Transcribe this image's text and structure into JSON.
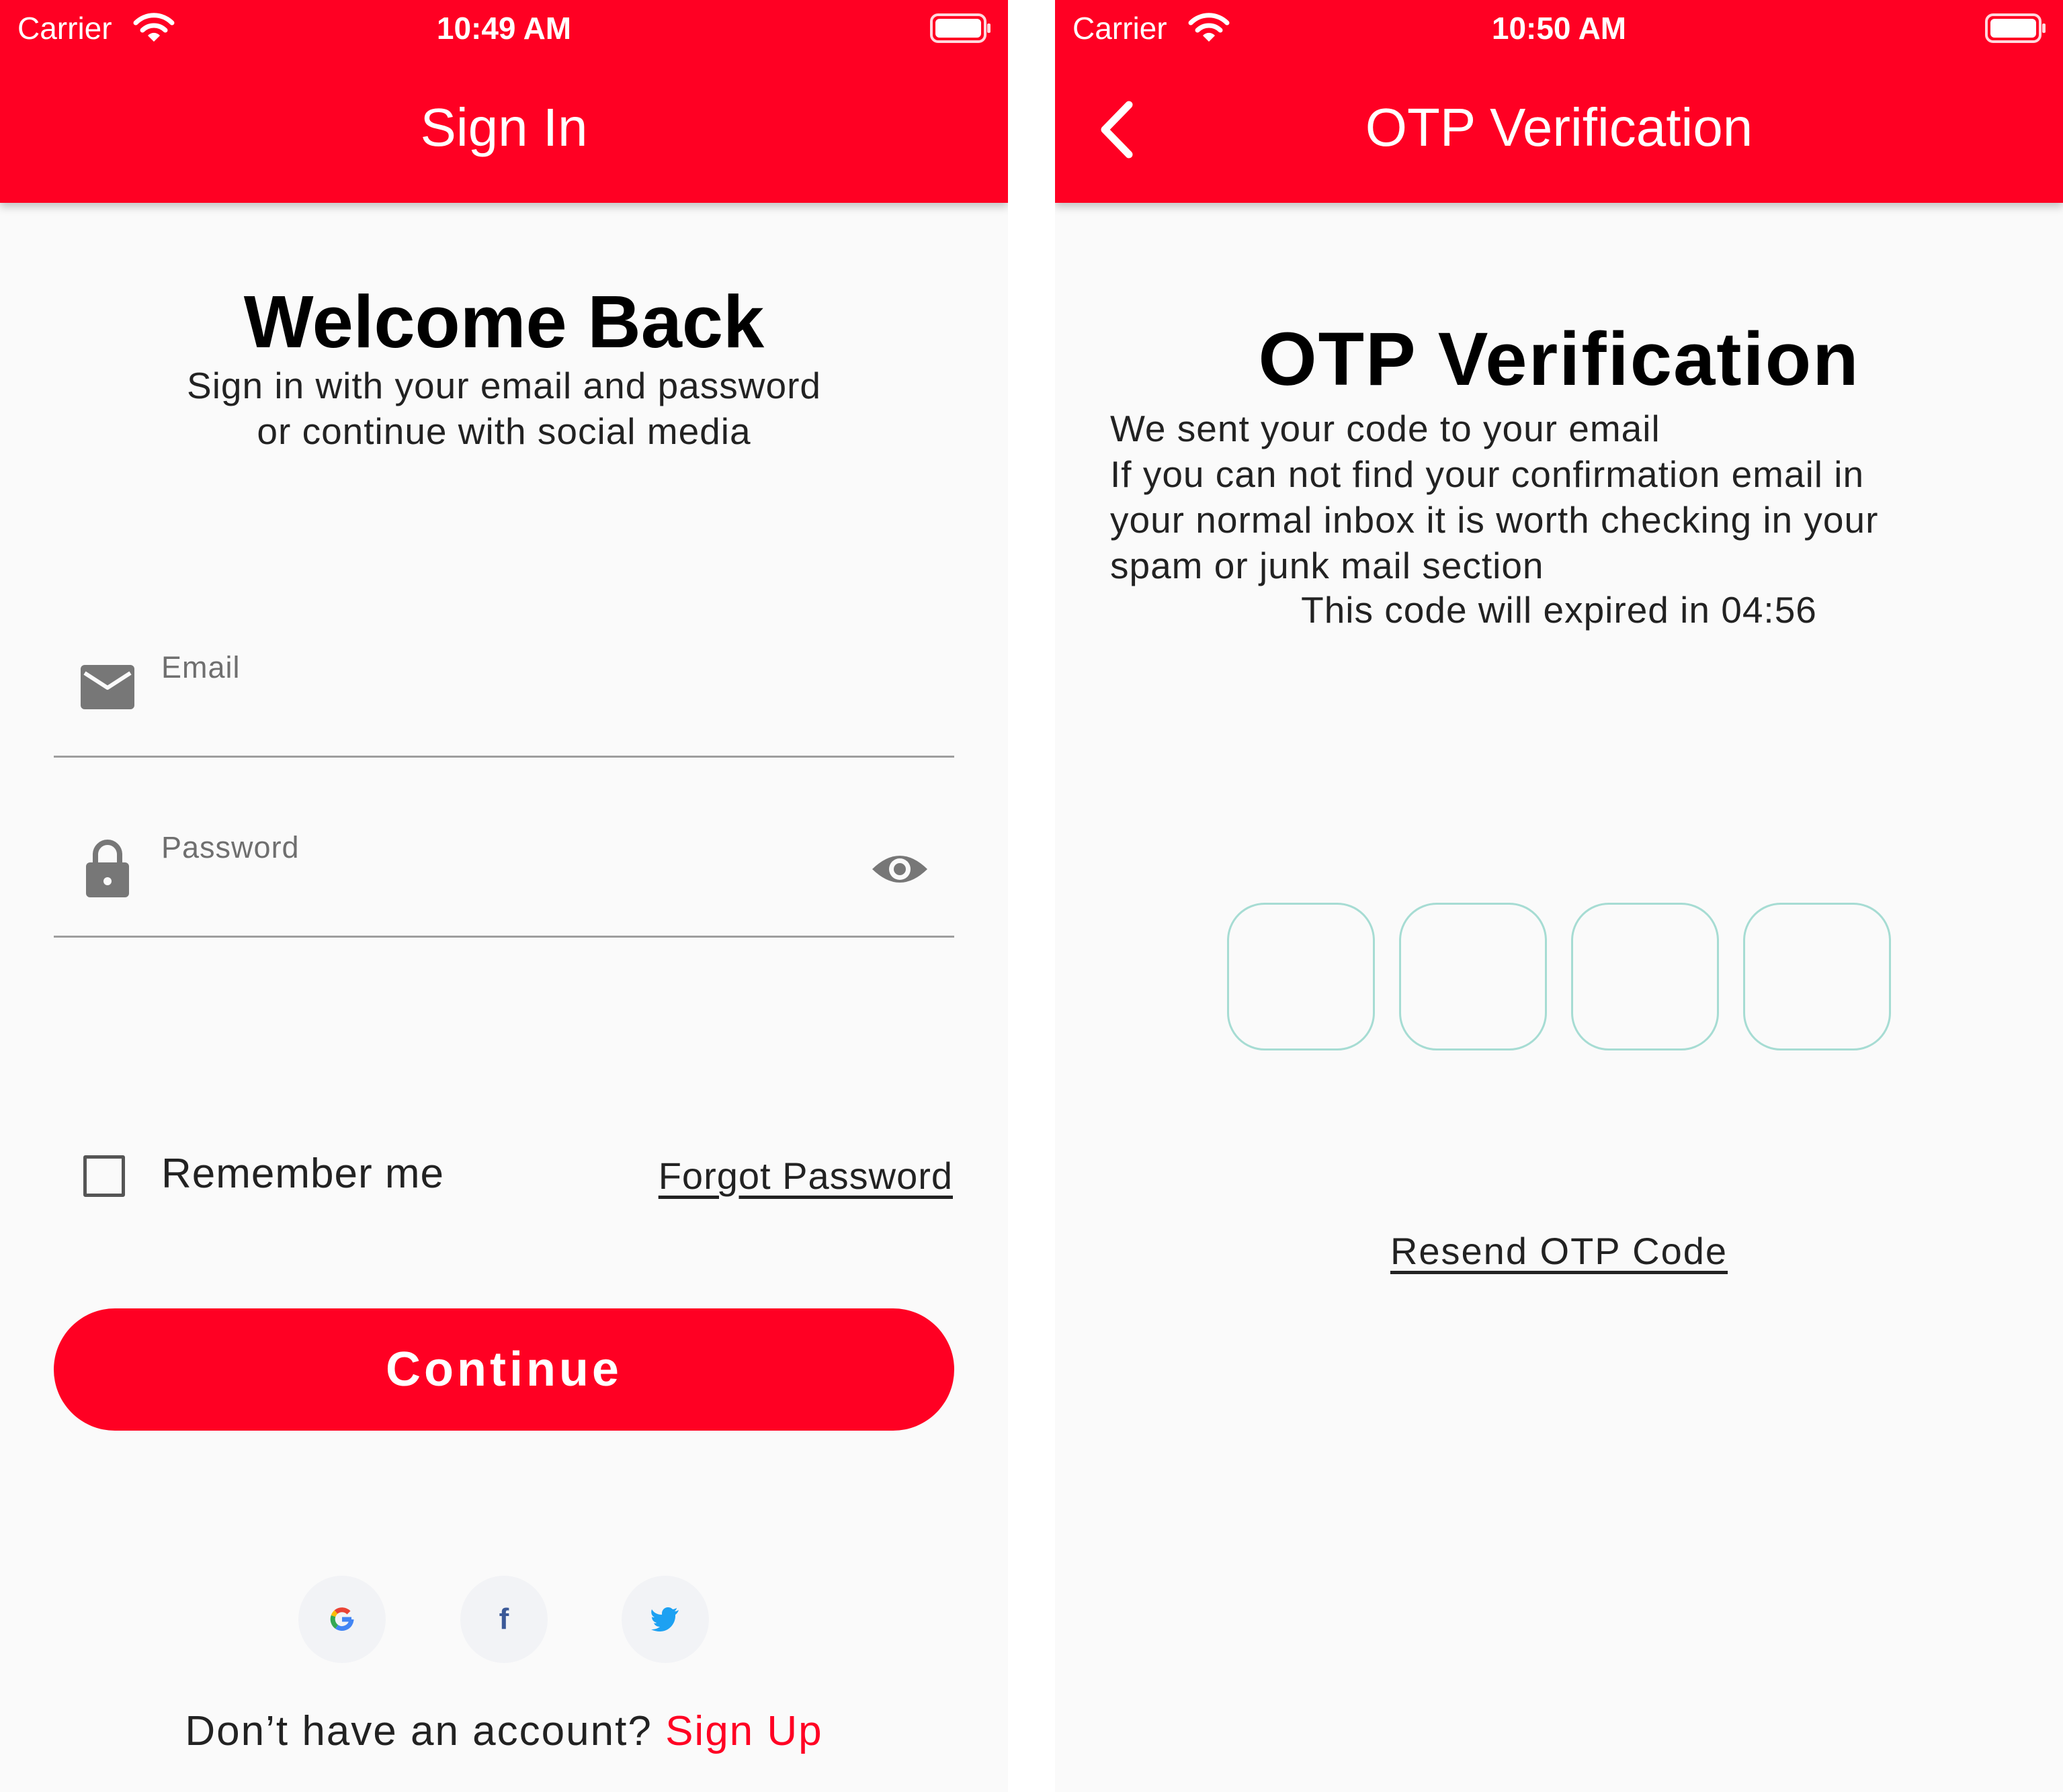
{
  "signin": {
    "status_bar": {
      "carrier": "Carrier",
      "time": "10:49 AM"
    },
    "title": "Sign In",
    "heading": "Welcome Back",
    "subtitle_line1": "Sign in with your email and password",
    "subtitle_line2": "or continue with social media",
    "email_label": "Email",
    "password_label": "Password",
    "remember_label": "Remember me",
    "remember_checked": false,
    "forgot_label": "Forgot Password",
    "continue_label": "Continue",
    "social_icons": [
      "google-icon",
      "facebook-icon",
      "twitter-icon"
    ],
    "no_account_text": "Don’t have an account?",
    "signup_link": "Sign Up"
  },
  "otp": {
    "status_bar": {
      "carrier": "Carrier",
      "time": "10:50 AM"
    },
    "title": "OTP Verification",
    "heading": "OTP Verification",
    "line1": "We sent your code to your email",
    "line2": "If you can not find your confirmation email in",
    "line3": "your normal inbox it is worth checking in your",
    "line4": "spam or junk mail section",
    "expire_text": "This code will expired in 04:56",
    "otp_boxes": 4,
    "resend_label": "Resend OTP Code"
  },
  "colors": {
    "primary": "#ff0023",
    "otp_border": "#a6dcd3",
    "background": "#fafafa"
  }
}
